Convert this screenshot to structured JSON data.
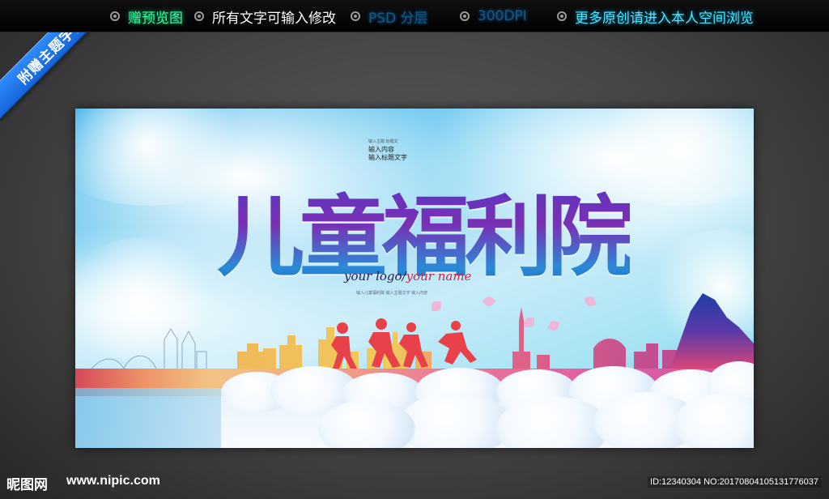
{
  "ribbon": {
    "label": "附赠主题字体"
  },
  "topbar": {
    "items": [
      {
        "label": "赠预览图",
        "color": "#35ff9a"
      },
      {
        "label": "所有文字可输入修改",
        "color": "#ffffff"
      },
      {
        "label": "PSD 分层",
        "color": "#1a5a78"
      },
      {
        "label": "300DPI",
        "color": "#1a5a78"
      },
      {
        "label": "更多原创请进入本人空间浏览",
        "color": "#46e8ff"
      }
    ]
  },
  "poster": {
    "title": "儿童福利院",
    "caption_top": "输入内容",
    "caption_bottom": "输入标题文字",
    "caption_tiny": "输入主题 标题文",
    "logo_text": "your logo/",
    "name_text": "your name",
    "fine_print": "输入儿童福利院 输入主题文字 输入内容"
  },
  "footer": {
    "logo": "昵图网",
    "url": "www.nipic.com",
    "id_text": "ID:12340304 NO:20170804105131776037"
  }
}
